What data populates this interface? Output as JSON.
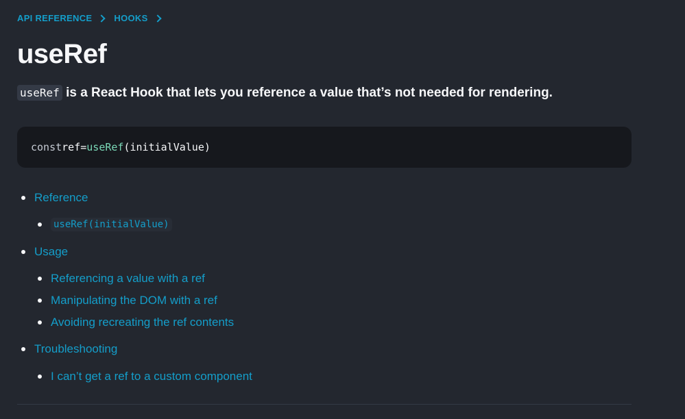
{
  "breadcrumb": {
    "items": [
      "API REFERENCE",
      "HOOKS"
    ]
  },
  "title": "useRef",
  "intro": {
    "code": "useRef",
    "text": " is a React Hook that lets you reference a value that’s not needed for rendering."
  },
  "code_block": {
    "keyword": "const",
    "variable": "ref",
    "operator": "=",
    "function": "useRef",
    "args": "(initialValue)"
  },
  "toc": {
    "reference": {
      "label": "Reference",
      "children": [
        "useRef(initialValue)"
      ]
    },
    "usage": {
      "label": "Usage",
      "children": [
        "Referencing a value with a ref",
        "Manipulating the DOM with a ref",
        "Avoiding recreating the ref contents"
      ]
    },
    "troubleshooting": {
      "label": "Troubleshooting",
      "children": [
        "I can’t get a ref to a custom component"
      ]
    }
  },
  "colors": {
    "background": "#23272f",
    "link": "#149eca",
    "code_bg": "#16181d",
    "function_token": "#7bd9b8"
  }
}
